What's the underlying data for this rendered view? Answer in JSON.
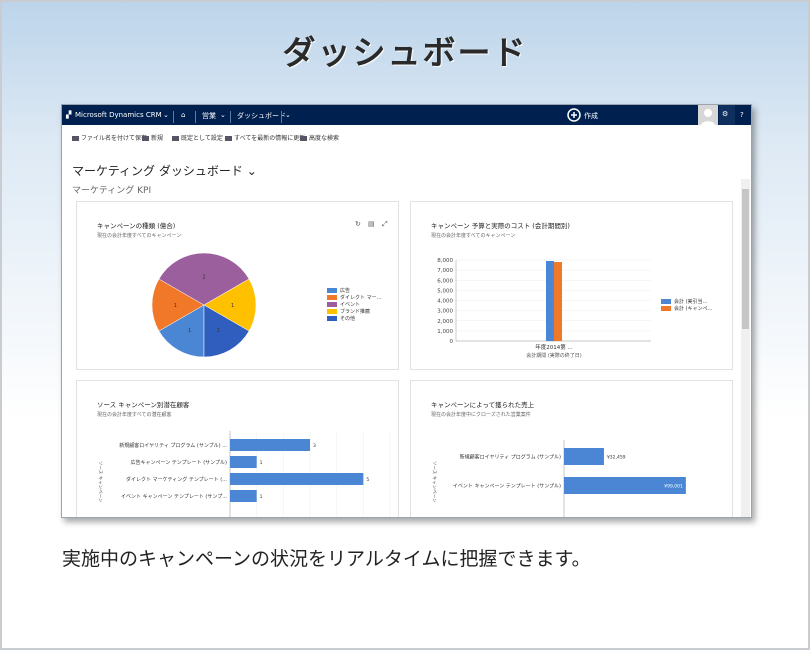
{
  "heading": "ダッシュボード",
  "caption": "実施中のキャンペーンの状況をリアルタイムに把握できます。",
  "colors": {
    "blue": "#4a86d4",
    "orange": "#f07828",
    "purple": "#9c5f9e",
    "yellow": "#ffc000",
    "navy": "#2f5ebf"
  },
  "nav": {
    "app": "Microsoft Dynamics CRM",
    "home_icon": "home-icon",
    "sales": "営業",
    "dashboard": "ダッシュボード",
    "create": "作成"
  },
  "commands": [
    "ファイル名を付けて保存",
    "新規",
    "既定として設定",
    "すべてを最新の情報に更新",
    "高度な検索"
  ],
  "dashboard_title": "マーケティング ダッシュボード",
  "dashboard_subtitle": "マーケティング KPI",
  "panels": {
    "pie": {
      "title": "キャンペーンの種類 (億合)",
      "subtitle": "現在の会計年度すべてのキャンペーン"
    },
    "bar": {
      "title": "キャンペーン 予算と実際のコスト (会計期間別)",
      "subtitle": "現在の会計年度すべてのキャンペーン",
      "xlabel": "会計期間 (実際の終了日)"
    },
    "leads": {
      "title": "ソース キャンペーン別潜在顧客",
      "subtitle": "現在の会計年度すべての潜在顧客",
      "ylabel": "ソース キャンペーン"
    },
    "revenue": {
      "title": "キャンペーンによって獲られた売上",
      "subtitle": "現在の会計年度中にクローズされた営業案件",
      "ylabel": "ソース キャンペーン"
    }
  },
  "chart_data": [
    {
      "type": "pie",
      "series": [
        {
          "name": "広告",
          "value": 1
        },
        {
          "name": "ダイレクト マー…",
          "value": 1
        },
        {
          "name": "イベント",
          "value": 2
        },
        {
          "name": "ブランド推薦",
          "value": 1
        },
        {
          "name": "その他",
          "value": 1
        }
      ],
      "slice_labels": [
        "1",
        "1",
        "2",
        "1",
        "1"
      ],
      "legend": "right"
    },
    {
      "type": "bar",
      "categories": [
        "年度2014第 ..."
      ],
      "series": [
        {
          "name": "会計 (実引当…",
          "values": [
            7900
          ]
        },
        {
          "name": "会計 (キャンペ…",
          "values": [
            7800
          ]
        }
      ],
      "yticks": [
        "0",
        "1,000",
        "2,000",
        "3,000",
        "4,000",
        "5,000",
        "6,000",
        "7,000",
        "8,000"
      ],
      "ylim": [
        0,
        8000
      ],
      "xlabel": "会計期間 (実際の終了日)",
      "legend": "right"
    },
    {
      "type": "bar",
      "orientation": "horizontal",
      "categories": [
        "新規顧客ロイヤリティ プログラム (サンプル) ...",
        "広告キャンペーン テンプレート (サンプル)",
        "ダイレクト マーケティング テンプレート (...",
        "イベント キャンペーン テンプレート (サンプ..."
      ],
      "values": [
        3,
        1,
        5,
        1
      ],
      "data_labels": [
        "3",
        "1",
        "5",
        "1"
      ],
      "xlim": [
        0,
        6
      ],
      "ylabel": "ソース キャンペーン"
    },
    {
      "type": "bar",
      "orientation": "horizontal",
      "categories": [
        "新規顧客ロイヤリティ プログラム (サンプル)",
        "イベント キャンペーン テンプレート (サンプル)"
      ],
      "values": [
        32459,
        99001
      ],
      "data_labels": [
        "¥32,459",
        "¥99,001"
      ],
      "ylabel": "ソース キャンペーン"
    }
  ]
}
